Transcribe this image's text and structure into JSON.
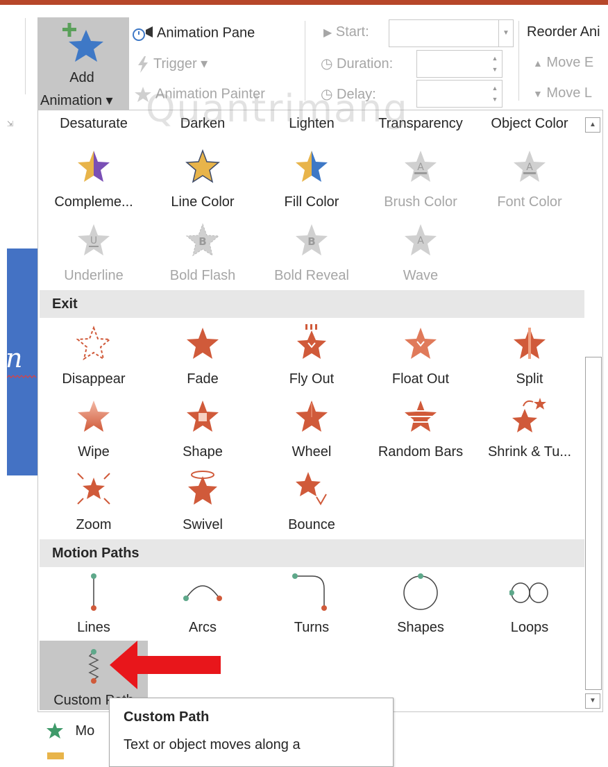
{
  "colors": {
    "accent_top": "#b7472a",
    "star_orange": "#d05a3a",
    "star_gold": "#e8b44a",
    "star_blue": "#4472c4",
    "star_purple": "#7a4fb5",
    "selection_gray": "#c6c6c6",
    "path_green": "#5ea88a",
    "path_red": "#d05a3a",
    "callout_red": "#e8161b"
  },
  "ribbon": {
    "add_animation": {
      "line1": "Add",
      "line2": "Animation ▾",
      "icon": "add-star-icon"
    },
    "animation_pane": "Animation Pane",
    "trigger": "Trigger ▾",
    "animation_painter": "Animation Painter",
    "start_label": "Start:",
    "start_value": "",
    "duration_label": "Duration:",
    "duration_value": "",
    "delay_label": "Delay:",
    "delay_value": "",
    "reorder_title": "Reorder Ani",
    "move_earlier": "Move E",
    "move_later": "Move L"
  },
  "watermark": "Quantrimang",
  "gallery": {
    "emphasis_row1": [
      "Desaturate",
      "Darken",
      "Lighten",
      "Transparency",
      "Object Color"
    ],
    "emphasis_row2": [
      {
        "label": "Compleme...",
        "icon": "star-complementary-icon",
        "enabled": true
      },
      {
        "label": "Line Color",
        "icon": "star-line-color-icon",
        "enabled": true
      },
      {
        "label": "Fill Color",
        "icon": "star-fill-color-icon",
        "enabled": true
      },
      {
        "label": "Brush Color",
        "icon": "star-brush-color-icon",
        "enabled": false
      },
      {
        "label": "Font Color",
        "icon": "star-font-color-icon",
        "enabled": false
      }
    ],
    "emphasis_row3": [
      {
        "label": "Underline",
        "icon": "star-underline-icon",
        "enabled": false
      },
      {
        "label": "Bold Flash",
        "icon": "star-bold-flash-icon",
        "enabled": false
      },
      {
        "label": "Bold Reveal",
        "icon": "star-bold-reveal-icon",
        "enabled": false
      },
      {
        "label": "Wave",
        "icon": "star-wave-icon",
        "enabled": false
      }
    ],
    "exit": {
      "header": "Exit",
      "row1": [
        "Disappear",
        "Fade",
        "Fly Out",
        "Float Out",
        "Split"
      ],
      "row2": [
        "Wipe",
        "Shape",
        "Wheel",
        "Random Bars",
        "Shrink & Tu..."
      ],
      "row3": [
        "Zoom",
        "Swivel",
        "Bounce"
      ]
    },
    "motion_paths": {
      "header": "Motion Paths",
      "row1": [
        "Lines",
        "Arcs",
        "Turns",
        "Shapes",
        "Loops"
      ],
      "custom_path": "Custom Path"
    }
  },
  "tooltip": {
    "title": "Custom Path",
    "body": "Text or object moves along a"
  },
  "bottom_list": {
    "item1": "Mo"
  }
}
